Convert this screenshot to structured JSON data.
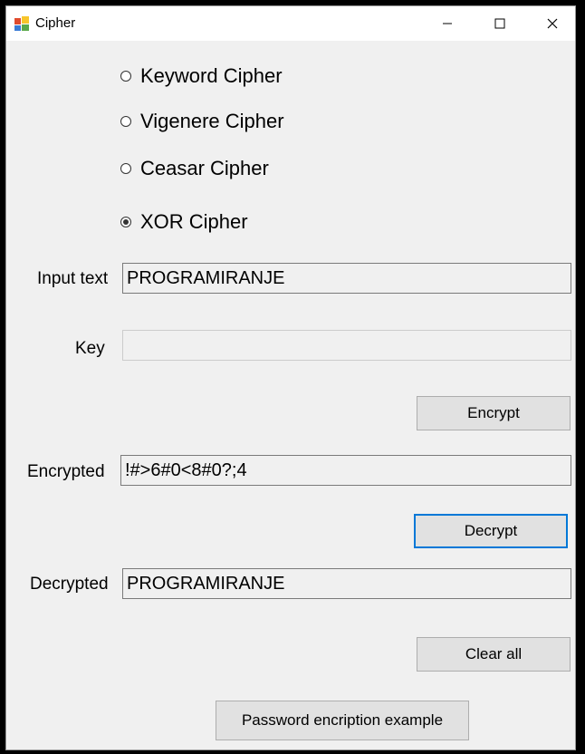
{
  "window": {
    "title": "Cipher"
  },
  "radios": [
    {
      "label": "Keyword Cipher",
      "checked": false
    },
    {
      "label": "Vigenere Cipher",
      "checked": false
    },
    {
      "label": "Ceasar Cipher",
      "checked": false
    },
    {
      "label": "XOR Cipher",
      "checked": true
    }
  ],
  "fields": {
    "input_label": "Input text",
    "input_value": "PROGRAMIRANJE",
    "key_label": "Key",
    "key_value": "",
    "encrypted_label": "Encrypted",
    "encrypted_value": "!#>6#0<8#0?;4",
    "decrypted_label": "Decrypted",
    "decrypted_value": "PROGRAMIRANJE"
  },
  "buttons": {
    "encrypt": "Encrypt",
    "decrypt": "Decrypt",
    "clear_all": "Clear all",
    "password_example": "Password encription example"
  },
  "colors": {
    "focus_border": "#0078d7",
    "form_background": "#f0f0f0"
  }
}
